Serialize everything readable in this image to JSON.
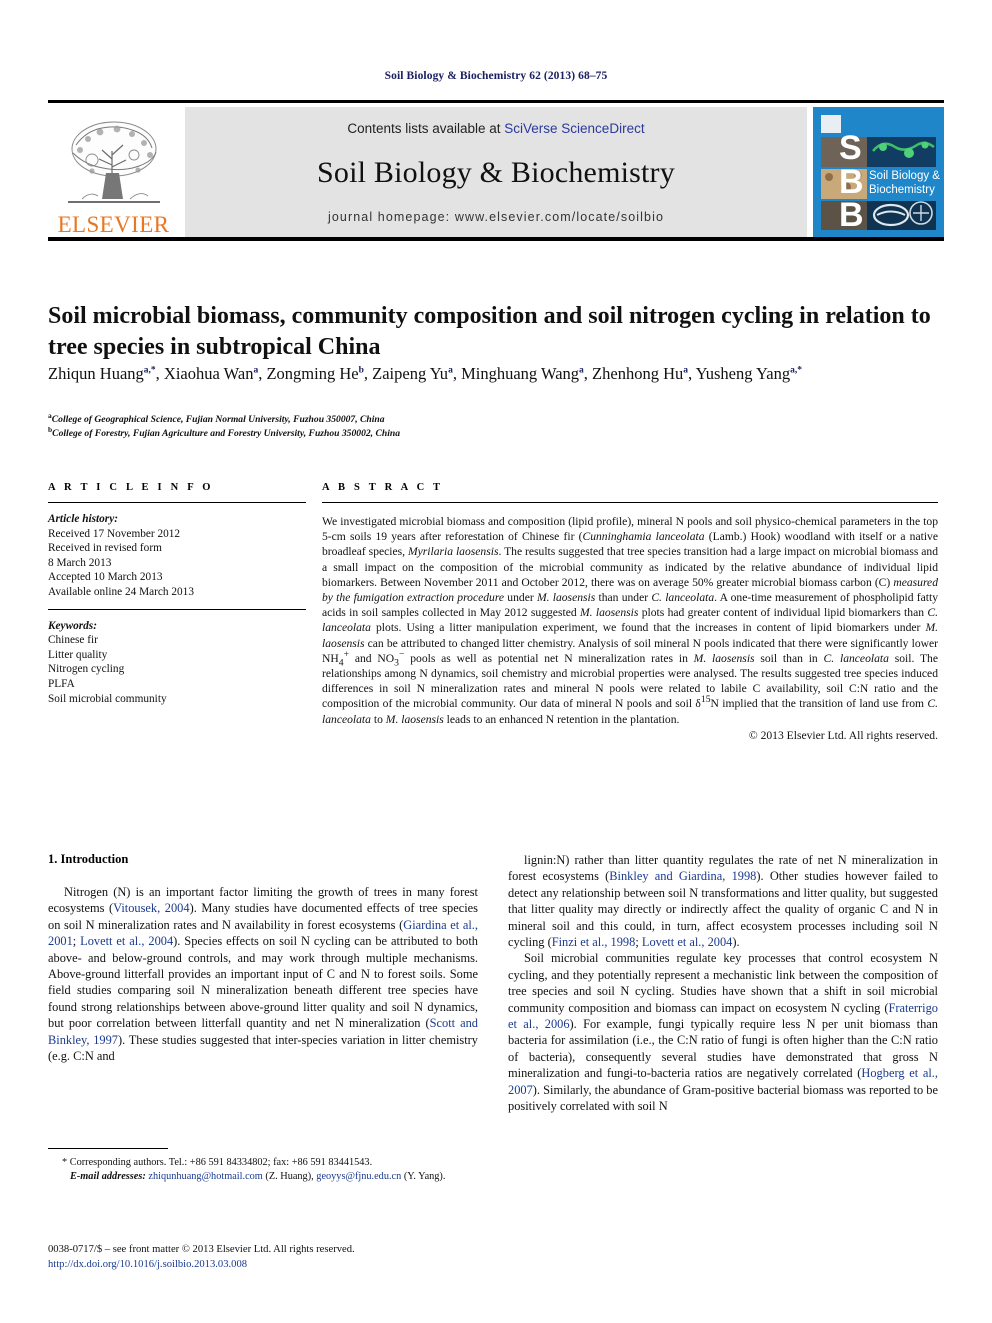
{
  "running_head": "Soil Biology & Biochemistry 62 (2013) 68–75",
  "masthead": {
    "publisher_logo_text": "ELSEVIER",
    "contents_prefix": "Contents lists available at ",
    "contents_link": "SciVerse ScienceDirect",
    "journal_name": "Soil Biology & Biochemistry",
    "homepage": "journal homepage: www.elsevier.com/locate/soilbio",
    "cover_letters": [
      "S",
      "B",
      "B"
    ],
    "cover_title_line1": "Soil Biology &",
    "cover_title_line2": "Biochemistry",
    "colors": {
      "elsevier_orange": "#E87722",
      "cover_blue": "#1e86c9",
      "link_blue": "#2a3a9c",
      "header_navy": "#1a2060",
      "panel_gray": "#e3e3e3"
    }
  },
  "article": {
    "title": "Soil microbial biomass, community composition and soil nitrogen cycling in relation to tree species in subtropical China",
    "authors_html": "Zhiqun Huang<sup>a,*</sup>, Xiaohua Wan<sup>a</sup>, Zongming He<sup>b</sup>, Zaipeng Yu<sup>a</sup>, Minghuang Wang<sup>a</sup>, Zhenhong Hu<sup>a</sup>, Yusheng Yang<sup>a,*</sup>",
    "affiliation_a": "College of Geographical Science, Fujian Normal University, Fuzhou 350007, China",
    "affiliation_b": "College of Forestry, Fujian Agriculture and Forestry University, Fuzhou 350002, China"
  },
  "article_info": {
    "heading": "A R T I C L E   I N F O",
    "history_label": "Article history:",
    "history": [
      "Received 17 November 2012",
      "Received in revised form",
      "8 March 2013",
      "Accepted 10 March 2013",
      "Available online 24 March 2013"
    ],
    "keywords_label": "Keywords:",
    "keywords": [
      "Chinese fir",
      "Litter quality",
      "Nitrogen cycling",
      "PLFA",
      "Soil microbial community"
    ]
  },
  "abstract": {
    "heading": "A B S T R A C T",
    "text_html": "We investigated microbial biomass and composition (lipid profile), mineral N pools and soil physico-chemical parameters in the top 5-cm soils 19 years after reforestation of Chinese fir (<i>Cunninghamia lanceolata</i> (Lamb.) Hook) woodland with itself or a native broadleaf species, <i>Myrilaria laosensis</i>. The results suggested that tree species transition had a large impact on microbial biomass and a small impact on the composition of the microbial community as indicated by the relative abundance of individual lipid biomarkers. Between November 2011 and October 2012, there was on average 50% greater microbial biomass carbon (C) <i>measured by the fumigation extraction procedure</i> under <i>M. laosensis</i> than under <i>C. lanceolata</i>. A one-time measurement of phospholipid fatty acids in soil samples collected in May 2012 suggested <i>M. laosensis</i> plots had greater content of individual lipid biomarkers than <i>C. lanceolata</i> plots. Using a litter manipulation experiment, we found that the increases in content of lipid biomarkers under <i>M. laosensis</i> can be attributed to changed litter chemistry. Analysis of soil mineral N pools indicated that there were significantly lower NH<sub>4</sub><sup>+</sup> and NO<sub>3</sub><sup>&#8722;</sup> pools as well as potential net N mineralization rates in <i>M. laosensis</i> soil than in <i>C. lanceolata</i> soil. The relationships among N dynamics, soil chemistry and microbial properties were analysed. The results suggested tree species induced differences in soil N mineralization rates and mineral N pools were related to labile C availability, soil C:N ratio and the composition of the microbial community. Our data of mineral N pools and soil &#948;<sup>15</sup>N implied that the transition of land use from <i>C. lanceolata</i> to <i>M. laosensis</i> leads to an enhanced N retention in the plantation.",
    "copyright": "© 2013 Elsevier Ltd. All rights reserved."
  },
  "body": {
    "section_heading": "1. Introduction",
    "left_paragraph_html": "Nitrogen (N) is an important factor limiting the growth of trees in many forest ecosystems (<span class=\"ref\">Vitousek, 2004</span>). Many studies have documented effects of tree species on soil N mineralization rates and N availability in forest ecosystems (<span class=\"ref\">Giardina et al., 2001</span>; <span class=\"ref\">Lovett et al., 2004</span>). Species effects on soil N cycling can be attributed to both above- and below-ground controls, and may work through multiple mechanisms. Above-ground litterfall provides an important input of C and N to forest soils. Some field studies comparing soil N mineralization beneath different tree species have found strong relationships between above-ground litter quality and soil N dynamics, but poor correlation between litterfall quantity and net N mineralization (<span class=\"ref\">Scott and Binkley, 1997</span>). These studies suggested that inter-species variation in litter chemistry (e.g. C:N and",
    "right_paragraph_1_html": "lignin:N) rather than litter quantity regulates the rate of net N mineralization in forest ecosystems (<span class=\"ref\">Binkley and Giardina, 1998</span>). Other studies however failed to detect any relationship between soil N transformations and litter quality, but suggested that litter quality may directly or indirectly affect the quality of organic C and N in mineral soil and this could, in turn, affect ecosystem processes including soil N cycling (<span class=\"ref\">Finzi et al., 1998</span>; <span class=\"ref\">Lovett et al., 2004</span>).",
    "right_paragraph_2_html": "Soil microbial communities regulate key processes that control ecosystem N cycling, and they potentially represent a mechanistic link between the composition of tree species and soil N cycling. Studies have shown that a shift in soil microbial community composition and biomass can impact on ecosystem N cycling (<span class=\"ref\">Fraterrigo et al., 2006</span>). For example, fungi typically require less N per unit biomass than bacteria for assimilation (i.e., the C:N ratio of fungi is often higher than the C:N ratio of bacteria), consequently several studies have demonstrated that gross N mineralization and fungi-to-bacteria ratios are negatively correlated (<span class=\"ref\">Hogberg et al., 2007</span>). Similarly, the abundance of Gram-positive bacterial biomass was reported to be positively correlated with soil N"
  },
  "footnotes": {
    "corresponding_html": "* Corresponding authors. Tel.: +86 591 84334802; fax: +86 591 83441543.",
    "email_html": "<span class=\"em\">E-mail addresses:</span> <span class=\"link\">zhiqunhuang@hotmail.com</span> (Z. Huang), <span class=\"link\">geoyys@fjnu.edu.cn</span> (Y. Yang).",
    "issn_line": "0038-0717/$ – see front matter © 2013 Elsevier Ltd. All rights reserved.",
    "doi_line": "http://dx.doi.org/10.1016/j.soilbio.2013.03.008"
  }
}
